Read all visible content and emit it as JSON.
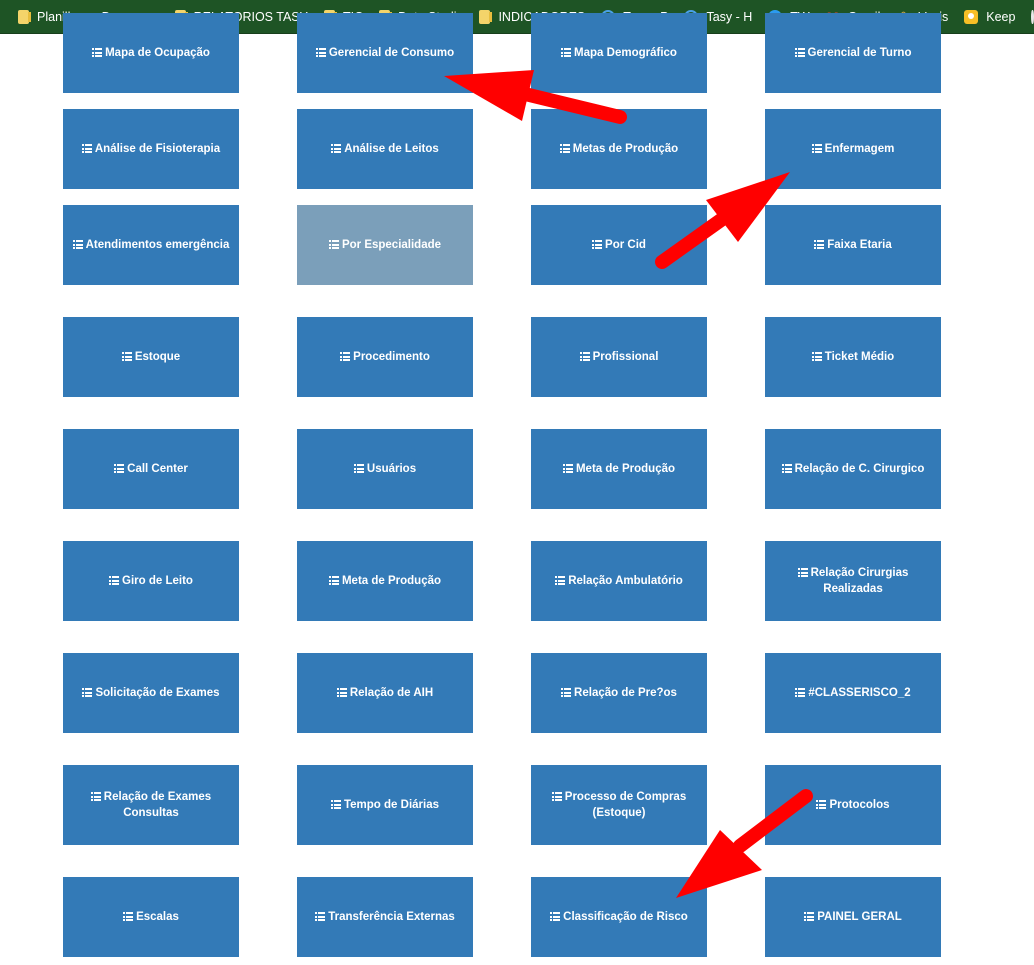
{
  "bookmarks": [
    {
      "label": "Planilhas e Docume...",
      "icon": "folder-icon"
    },
    {
      "label": "RELATORIOS TASY",
      "icon": "folder-icon"
    },
    {
      "label": "TIC",
      "icon": "folder-icon"
    },
    {
      "label": "Data Studio",
      "icon": "folder-icon"
    },
    {
      "label": "INDICADORES",
      "icon": "folder-icon"
    },
    {
      "label": "Tasy - P",
      "icon": "tasy-icon"
    },
    {
      "label": "Tasy - H",
      "icon": "tasy-icon"
    },
    {
      "label": "TW",
      "icon": "teamviewer-icon"
    },
    {
      "label": "Gmail",
      "icon": "gmail-icon"
    },
    {
      "label": "Voxis",
      "icon": "voxis-icon"
    },
    {
      "label": "Keep",
      "icon": "keep-icon"
    }
  ],
  "tiles": [
    [
      "Mapa de Ocupação",
      "Gerencial de Consumo",
      "Mapa Demográfico",
      "Gerencial de Turno"
    ],
    [
      "Análise de Fisioterapia",
      "Análise de Leitos",
      "Metas de Produção",
      "Enfermagem"
    ],
    [
      "Atendimentos emergência",
      "Por Especialidade",
      "Por Cid",
      "Faixa Etaria"
    ],
    [
      "Estoque",
      "Procedimento",
      "Profissional",
      "Ticket Médio"
    ],
    [
      "Call Center",
      "Usuários",
      "Meta de Produção",
      "Relação de C. Cirurgico"
    ],
    [
      "Giro de Leito",
      "Meta de Produção",
      "Relação Ambulatório",
      "Relação Cirurgias Realizadas"
    ],
    [
      "Solicitação de Exames",
      "Relação de AIH",
      "Relação de Pre?os",
      "#CLASSERISCO_2"
    ],
    [
      "Relação de Exames Consultas",
      "Tempo de Diárias",
      "Processo de Compras (Estoque)",
      "Protocolos"
    ],
    [
      "Escalas",
      "Transferência Externas",
      "Classificação de Risco",
      "PAINEL GERAL"
    ]
  ],
  "colors": {
    "tile": "#337ab7",
    "tile_muted": "#7b9fba",
    "bookmark_bar": "#1e5425",
    "arrow": "#ff0000"
  }
}
